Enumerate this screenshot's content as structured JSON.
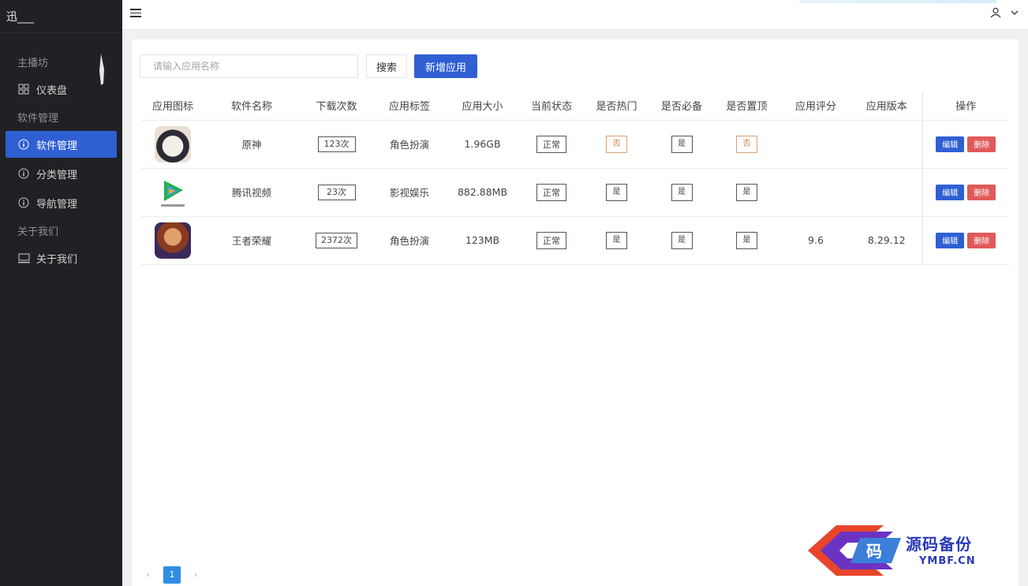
{
  "sidebar": {
    "brand": "迅___",
    "groups": [
      {
        "label": "主播坊",
        "items": [
          {
            "label": "仪表盘",
            "icon": "dashboard-icon"
          }
        ]
      },
      {
        "label": "软件管理",
        "items": [
          {
            "label": "软件管理",
            "icon": "info-icon",
            "active": true
          },
          {
            "label": "分类管理",
            "icon": "info-icon"
          },
          {
            "label": "导航管理",
            "icon": "info-icon"
          }
        ]
      },
      {
        "label": "关于我们",
        "items": [
          {
            "label": "关于我们",
            "icon": "monitor-icon"
          }
        ]
      }
    ]
  },
  "toolbar": {
    "search_placeholder": "请输入应用名称",
    "search_label": "搜索",
    "add_label": "新增应用"
  },
  "table": {
    "headers": [
      "应用图标",
      "软件名称",
      "下载次数",
      "应用标签",
      "应用大小",
      "当前状态",
      "是否热门",
      "是否必备",
      "是否置顶",
      "应用评分",
      "应用版本",
      "操作"
    ],
    "rows": [
      {
        "icon": "yuanshen-app-icon",
        "name": "原神",
        "downloads": "123次",
        "tag": "角色扮演",
        "size": "1.96GB",
        "status": "正常",
        "hot": "否",
        "must": "是",
        "top": "否",
        "rating": "",
        "version": "",
        "edit": "编辑",
        "delete": "删除"
      },
      {
        "icon": "tencent-video-app-icon",
        "name": "腾讯视频",
        "downloads": "23次",
        "tag": "影视娱乐",
        "size": "882.88MB",
        "status": "正常",
        "hot": "是",
        "must": "是",
        "top": "是",
        "rating": "",
        "version": "",
        "edit": "编辑",
        "delete": "删除"
      },
      {
        "icon": "wzry-app-icon",
        "name": "王者荣耀",
        "downloads": "2372次",
        "tag": "角色扮演",
        "size": "123MB",
        "status": "正常",
        "hot": "是",
        "must": "是",
        "top": "是",
        "rating": "9.6",
        "version": "8.29.12",
        "edit": "编辑",
        "delete": "删除"
      }
    ]
  },
  "pagination": {
    "prev": "‹",
    "current": "1",
    "next": "›"
  },
  "watermark": {
    "title": "源码备份",
    "url": "YMBF.CN",
    "logo_char": "码"
  },
  "colors": {
    "sidebar_bg": "#1f2124",
    "primary": "#2f5fd3",
    "danger": "#e05a5a"
  }
}
